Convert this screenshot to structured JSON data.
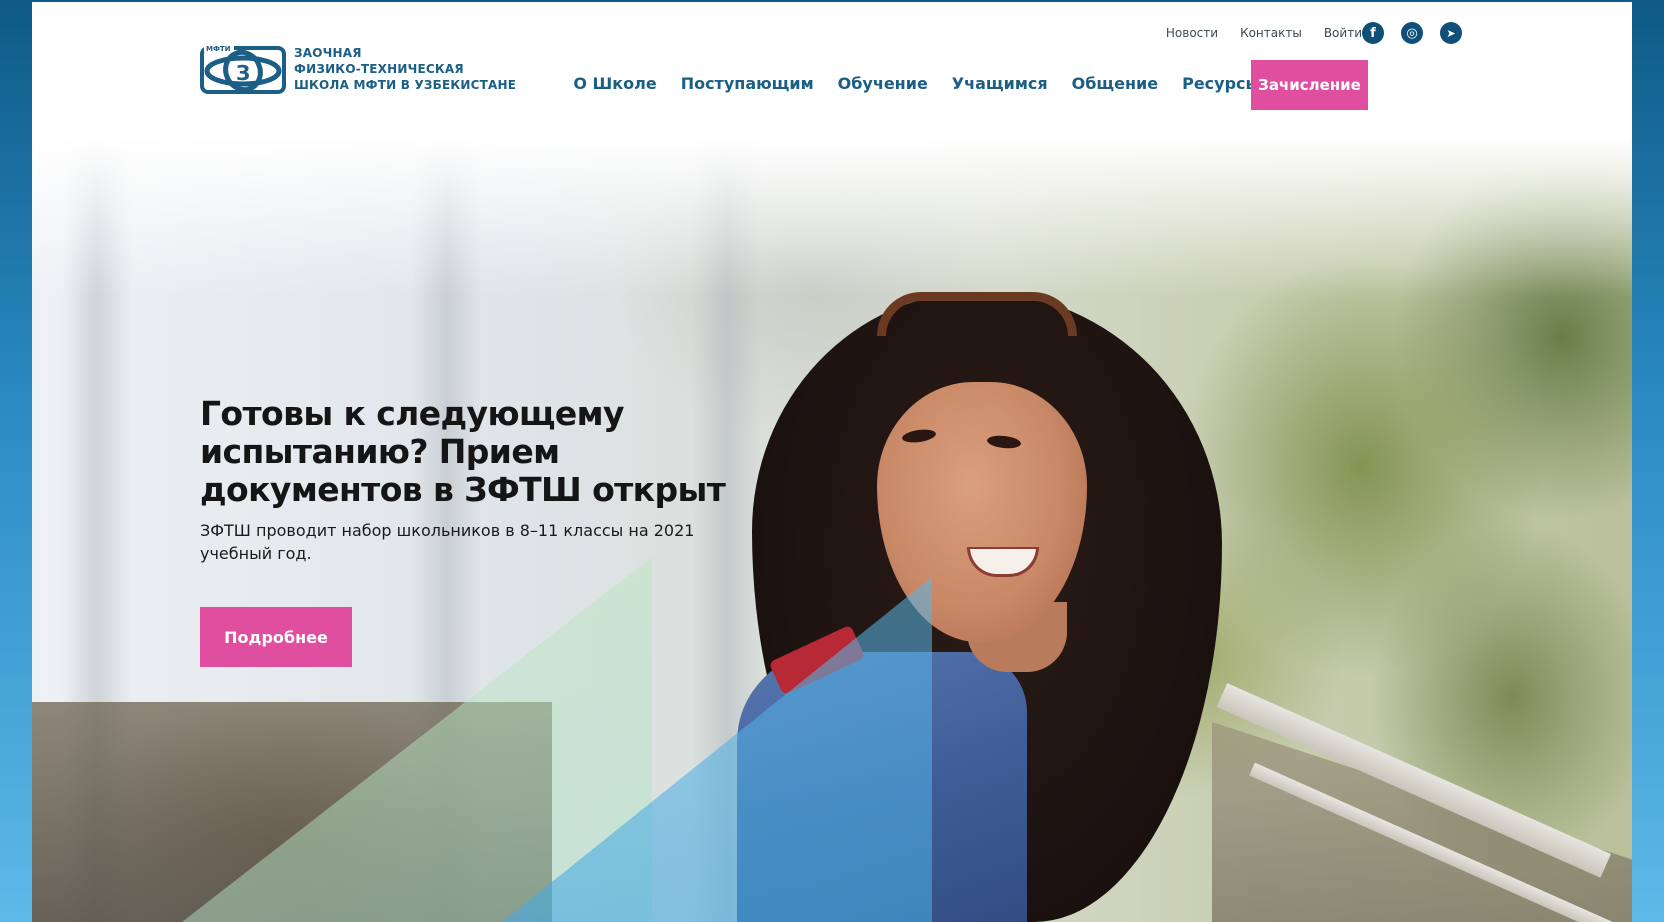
{
  "logo": {
    "mark_text": "МФТИ",
    "line1": "ЗАОЧНАЯ",
    "line2": "ФИЗИКО-ТЕХНИЧЕСКАЯ",
    "line3": "ШКОЛА МФТИ В УЗБЕКИСТАНЕ"
  },
  "top_links": [
    "Новости",
    "Контакты",
    "Войти"
  ],
  "social": [
    {
      "icon": "facebook-icon",
      "glyph": "f"
    },
    {
      "icon": "instagram-icon",
      "glyph": "◎"
    },
    {
      "icon": "telegram-icon",
      "glyph": "➤"
    }
  ],
  "nav": [
    "О Школе",
    "Поступающим",
    "Обучение",
    "Учащимся",
    "Общение",
    "Ресурсы"
  ],
  "enroll_button": "Зачисление",
  "hero": {
    "title": "Готовы к следующему испытанию? Прием документов в ЗФТШ открыт",
    "subtitle": "ЗФТШ проводит набор школьников в 8–11 классы на 2021 учебный год.",
    "button": "Подробнее"
  },
  "colors": {
    "brand_blue": "#1b5e86",
    "accent_pink": "#e04ea0",
    "social_blue": "#0f4f78"
  }
}
